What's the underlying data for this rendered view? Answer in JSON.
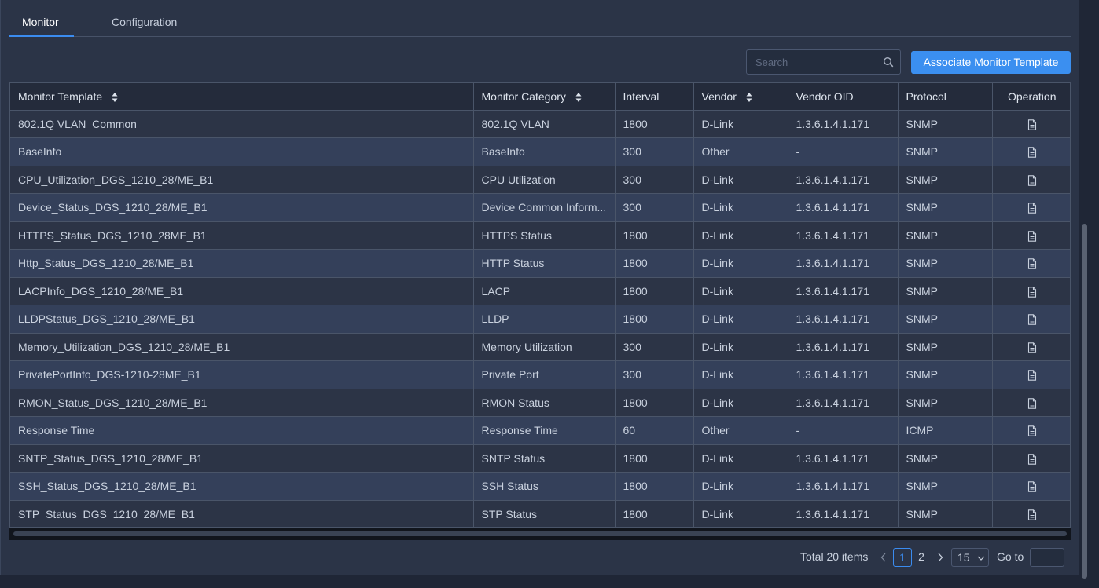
{
  "tabs": [
    {
      "label": "Monitor",
      "active": true
    },
    {
      "label": "Configuration",
      "active": false
    }
  ],
  "search": {
    "placeholder": "Search",
    "value": ""
  },
  "toolbar": {
    "associate_label": "Associate Monitor Template"
  },
  "table": {
    "columns": [
      {
        "label": "Monitor Template",
        "sortable": true
      },
      {
        "label": "Monitor Category",
        "sortable": true
      },
      {
        "label": "Interval",
        "sortable": false
      },
      {
        "label": "Vendor",
        "sortable": true
      },
      {
        "label": "Vendor OID",
        "sortable": false
      },
      {
        "label": "Protocol",
        "sortable": false
      },
      {
        "label": "Operation",
        "sortable": false
      }
    ],
    "operation_icon": "document-icon",
    "rows": [
      {
        "template": "802.1Q VLAN_Common",
        "category": "802.1Q VLAN",
        "interval": "1800",
        "vendor": "D-Link",
        "oid": "1.3.6.1.4.1.171",
        "protocol": "SNMP"
      },
      {
        "template": "BaseInfo",
        "category": "BaseInfo",
        "interval": "300",
        "vendor": "Other",
        "oid": "-",
        "protocol": "SNMP"
      },
      {
        "template": "CPU_Utilization_DGS_1210_28/ME_B1",
        "category": "CPU Utilization",
        "interval": "300",
        "vendor": "D-Link",
        "oid": "1.3.6.1.4.1.171",
        "protocol": "SNMP"
      },
      {
        "template": "Device_Status_DGS_1210_28/ME_B1",
        "category": "Device Common Inform...",
        "interval": "300",
        "vendor": "D-Link",
        "oid": "1.3.6.1.4.1.171",
        "protocol": "SNMP"
      },
      {
        "template": "HTTPS_Status_DGS_1210_28ME_B1",
        "category": "HTTPS Status",
        "interval": "1800",
        "vendor": "D-Link",
        "oid": "1.3.6.1.4.1.171",
        "protocol": "SNMP"
      },
      {
        "template": "Http_Status_DGS_1210_28/ME_B1",
        "category": "HTTP Status",
        "interval": "1800",
        "vendor": "D-Link",
        "oid": "1.3.6.1.4.1.171",
        "protocol": "SNMP"
      },
      {
        "template": "LACPInfo_DGS_1210_28/ME_B1",
        "category": "LACP",
        "interval": "1800",
        "vendor": "D-Link",
        "oid": "1.3.6.1.4.1.171",
        "protocol": "SNMP"
      },
      {
        "template": "LLDPStatus_DGS_1210_28/ME_B1",
        "category": "LLDP",
        "interval": "1800",
        "vendor": "D-Link",
        "oid": "1.3.6.1.4.1.171",
        "protocol": "SNMP"
      },
      {
        "template": "Memory_Utilization_DGS_1210_28/ME_B1",
        "category": "Memory Utilization",
        "interval": "300",
        "vendor": "D-Link",
        "oid": "1.3.6.1.4.1.171",
        "protocol": "SNMP"
      },
      {
        "template": "PrivatePortInfo_DGS-1210-28ME_B1",
        "category": "Private Port",
        "interval": "300",
        "vendor": "D-Link",
        "oid": "1.3.6.1.4.1.171",
        "protocol": "SNMP"
      },
      {
        "template": "RMON_Status_DGS_1210_28/ME_B1",
        "category": "RMON Status",
        "interval": "1800",
        "vendor": "D-Link",
        "oid": "1.3.6.1.4.1.171",
        "protocol": "SNMP"
      },
      {
        "template": "Response Time",
        "category": "Response Time",
        "interval": "60",
        "vendor": "Other",
        "oid": "-",
        "protocol": "ICMP"
      },
      {
        "template": "SNTP_Status_DGS_1210_28/ME_B1",
        "category": "SNTP Status",
        "interval": "1800",
        "vendor": "D-Link",
        "oid": "1.3.6.1.4.1.171",
        "protocol": "SNMP"
      },
      {
        "template": "SSH_Status_DGS_1210_28/ME_B1",
        "category": "SSH Status",
        "interval": "1800",
        "vendor": "D-Link",
        "oid": "1.3.6.1.4.1.171",
        "protocol": "SNMP"
      },
      {
        "template": "STP_Status_DGS_1210_28/ME_B1",
        "category": "STP Status",
        "interval": "1800",
        "vendor": "D-Link",
        "oid": "1.3.6.1.4.1.171",
        "protocol": "SNMP"
      }
    ]
  },
  "pagination": {
    "total_label": "Total 20 items",
    "pages": [
      "1",
      "2"
    ],
    "current_page": "1",
    "page_size": "15",
    "goto_label": "Go to",
    "goto_value": ""
  },
  "colors": {
    "accent": "#3b8cf0",
    "background": "#2b3447",
    "row_alt": "#34405a"
  }
}
